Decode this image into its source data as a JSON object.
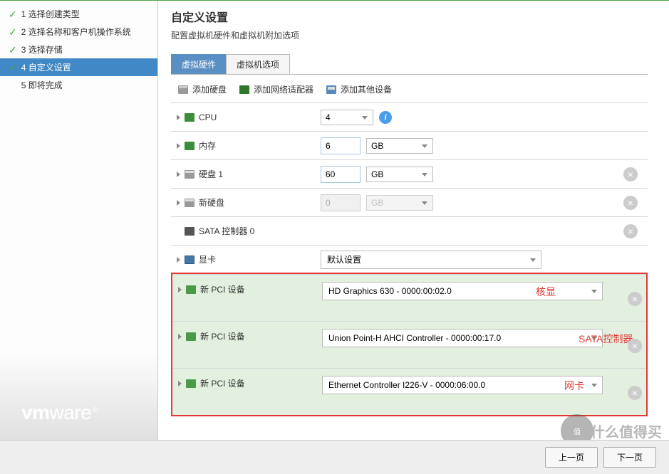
{
  "sidebar": {
    "steps": [
      {
        "label": "1 选择创建类型",
        "done": true,
        "active": false
      },
      {
        "label": "2 选择名称和客户机操作系统",
        "done": true,
        "active": false
      },
      {
        "label": "3 选择存储",
        "done": true,
        "active": false
      },
      {
        "label": "4 自定义设置",
        "done": true,
        "active": true
      },
      {
        "label": "5 即将完成",
        "done": false,
        "active": false
      }
    ],
    "logo_vm": "vm",
    "logo_ware": "ware"
  },
  "header": {
    "title": "自定义设置",
    "subtitle": "配置虚拟机硬件和虚拟机附加选项"
  },
  "tabs": [
    {
      "label": "虚拟硬件",
      "active": true
    },
    {
      "label": "虚拟机选项",
      "active": false
    }
  ],
  "toolbar": {
    "add_disk": "添加硬盘",
    "add_nic": "添加网络适配器",
    "add_other": "添加其他设备"
  },
  "hardware": {
    "cpu": {
      "label": "CPU",
      "value": "4"
    },
    "memory": {
      "label": "内存",
      "value": "6",
      "unit": "GB"
    },
    "disk1": {
      "label": "硬盘 1",
      "value": "60",
      "unit": "GB"
    },
    "disk_new": {
      "label": "新硬盘",
      "value": "0",
      "unit": "GB"
    },
    "sata": {
      "label": "SATA 控制器 0"
    },
    "vga": {
      "label": "显卡",
      "value": "默认设置"
    },
    "pci": [
      {
        "label": "新 PCI 设备",
        "value": "HD Graphics 630 - 0000:00:02.0",
        "anno": "核显"
      },
      {
        "label": "新 PCI 设备",
        "value": "Union Point-H AHCI Controller - 0000:00:17.0",
        "anno": "SATA控制器"
      },
      {
        "label": "新 PCI 设备",
        "value": "Ethernet Controller I226-V - 0000:06:00.0",
        "anno": "网卡"
      }
    ]
  },
  "footer": {
    "prev": "上一页",
    "next": "下一页"
  },
  "watermark": {
    "circle": "值",
    "text": "什么值得买"
  }
}
